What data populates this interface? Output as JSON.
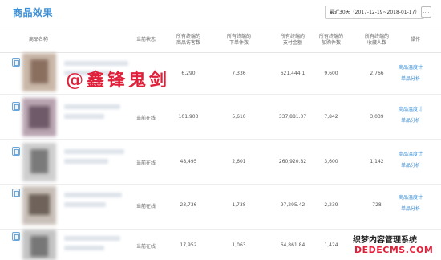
{
  "header": {
    "title": "商品效果",
    "date_range": "最近30天（2017-12-19~2018-01-17）",
    "calendar_icon": "calendar-icon"
  },
  "table": {
    "columns": {
      "name": "商品名称",
      "status": "当前状态",
      "visitors": [
        "所有终端的",
        "商品访客数"
      ],
      "order_items": [
        "所有终端的",
        "下单件数"
      ],
      "pay_amount": [
        "所有终端的",
        "支付金额"
      ],
      "cart_items": [
        "所有终端的",
        "加购件数"
      ],
      "favorites": [
        "所有终端的",
        "收藏人数"
      ],
      "action": "操作"
    },
    "rows": [
      {
        "status": "",
        "visitors": "6,290",
        "order_items": "7,336",
        "pay_amount": "621,444.1",
        "cart_items": "9,600",
        "favorites": "2,766",
        "link1": "商品温度计",
        "link2": "单品分析"
      },
      {
        "status": "当前在线",
        "visitors": "101,903",
        "order_items": "5,610",
        "pay_amount": "337,881.07",
        "cart_items": "7,842",
        "favorites": "3,039",
        "link1": "商品温度计",
        "link2": "单品分析"
      },
      {
        "status": "当前在线",
        "visitors": "48,495",
        "order_items": "2,601",
        "pay_amount": "260,920.82",
        "cart_items": "3,600",
        "favorites": "1,142",
        "link1": "商品温度计",
        "link2": "单品分析"
      },
      {
        "status": "当前在线",
        "visitors": "23,736",
        "order_items": "1,738",
        "pay_amount": "97,295.42",
        "cart_items": "2,239",
        "favorites": "728",
        "link1": "商品温度计",
        "link2": "单品分析"
      },
      {
        "status": "当前在线",
        "visitors": "17,952",
        "order_items": "1,063",
        "pay_amount": "64,861.84",
        "cart_items": "1,424",
        "favorites": "",
        "link1": "",
        "link2": ""
      }
    ]
  },
  "watermark": "@鑫锋鬼剑",
  "site_badge": {
    "cn": "织梦内容管理系统",
    "en": "DEDECMS.COM"
  }
}
